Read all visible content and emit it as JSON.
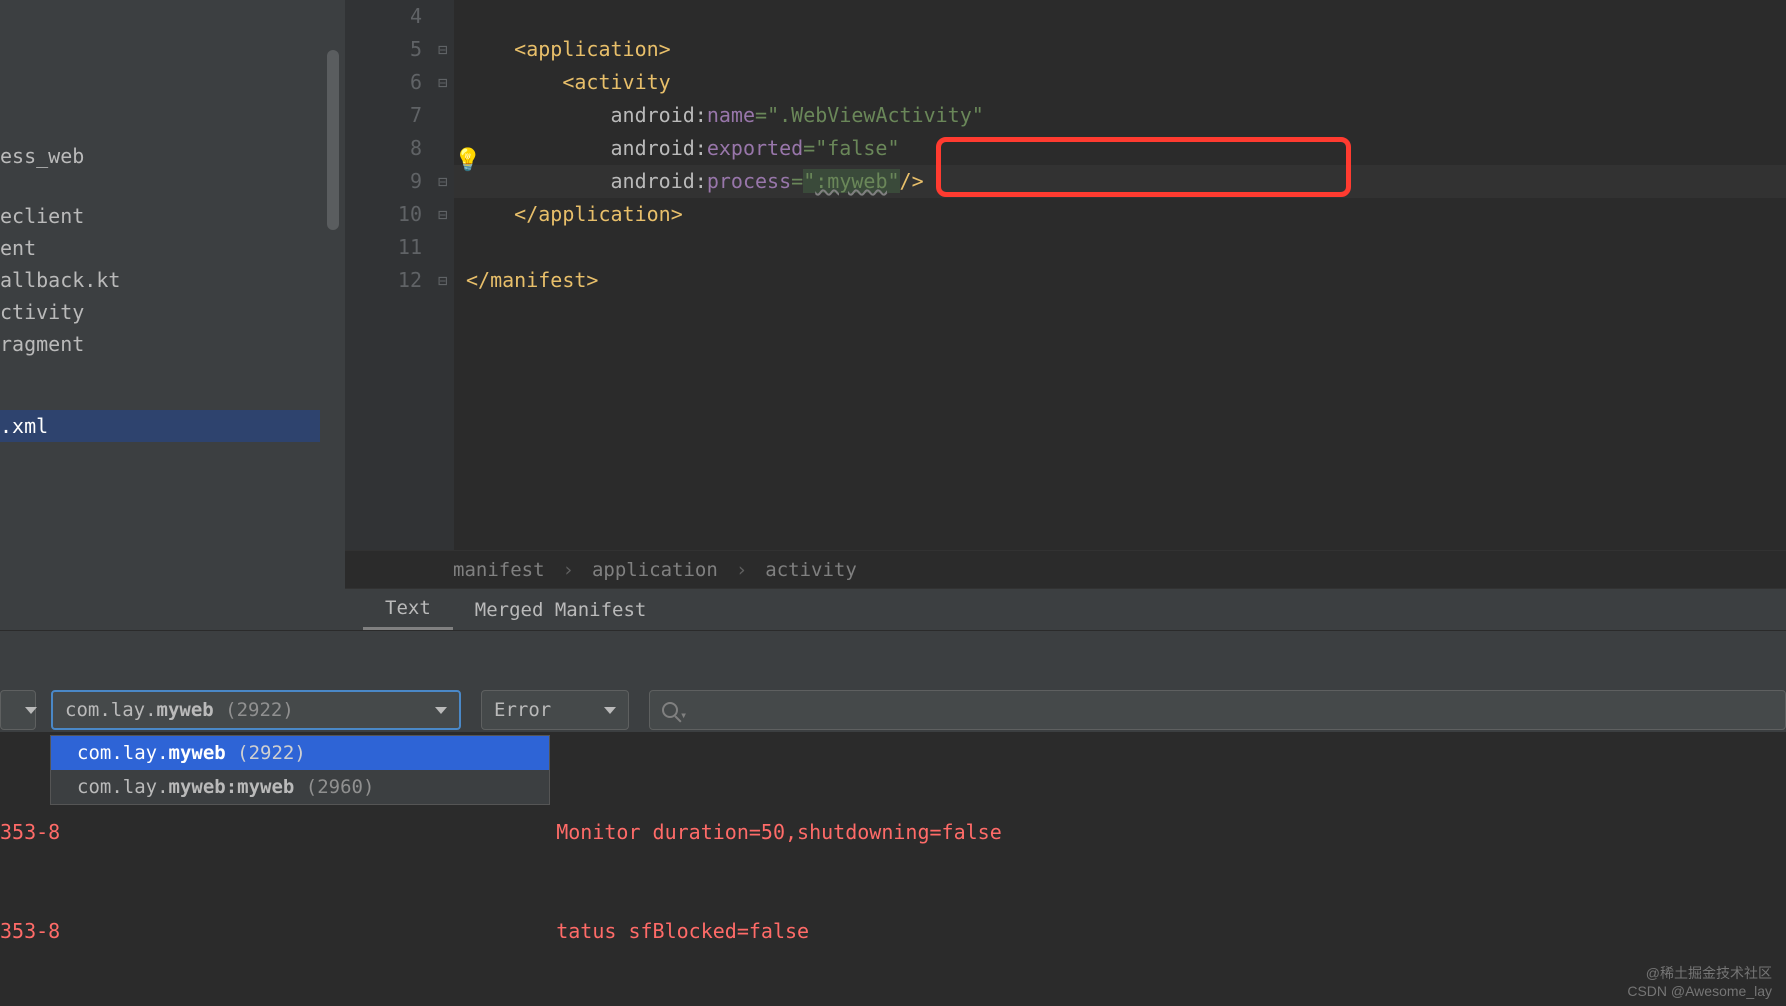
{
  "sidebar": {
    "items": [
      {
        "label": "ess_web"
      },
      {
        "label": "eclient"
      },
      {
        "label": "ent"
      },
      {
        "label": "allback.kt"
      },
      {
        "label": "ctivity"
      },
      {
        "label": "ragment"
      },
      {
        "label": ".xml",
        "selected": true
      }
    ]
  },
  "editor": {
    "lines": [
      "4",
      "5",
      "6",
      "7",
      "8",
      "9",
      "10",
      "11",
      "12"
    ],
    "code": {
      "l5": {
        "indent": "    ",
        "tag_open": "<",
        "tag": "application",
        "tag_close": ">"
      },
      "l6": {
        "indent": "        ",
        "tag_open": "<",
        "tag": "activity"
      },
      "l7": {
        "indent": "            ",
        "ns": "android",
        "colon": ":",
        "name": "name",
        "eq": "=",
        "q1": "\"",
        "val": ".WebViewActivity",
        "q2": "\""
      },
      "l8": {
        "indent": "            ",
        "ns": "android",
        "colon": ":",
        "name": "exported",
        "eq": "=",
        "q1": "\"",
        "val": "false",
        "q2": "\""
      },
      "l9": {
        "indent": "            ",
        "ns": "android",
        "colon": ":",
        "name": "process",
        "eq": "=",
        "q1": "\"",
        "val": ":myweb",
        "q2": "\"",
        "close": "/>"
      },
      "l10": {
        "indent": "    ",
        "tag_open": "</",
        "tag": "application",
        "tag_close": ">"
      },
      "l12": {
        "tag_open": "</",
        "tag": "manifest",
        "tag_close": ">"
      }
    }
  },
  "breadcrumb": {
    "items": [
      "manifest",
      "application",
      "activity"
    ]
  },
  "tabs": {
    "items": [
      {
        "label": "Text",
        "active": true
      },
      {
        "label": "Merged Manifest",
        "active": false
      }
    ]
  },
  "logcat": {
    "process_dropdown": {
      "prefix": "com.lay.",
      "bold": "myweb",
      "suffix": " (2922)"
    },
    "level_dropdown": "Error",
    "popup_items": [
      {
        "prefix": "com.lay.",
        "bold": "myweb",
        "suffix": " (2922)",
        "selected": true
      },
      {
        "prefix": "com.lay.",
        "bold": "myweb:myweb",
        "suffix": " (2960)",
        "selected": false
      }
    ]
  },
  "log_lines": {
    "l1a": "353-8",
    "l1b": "Monitor duration=50,shutdowning=false",
    "l2a": "353-8",
    "l2b": "tatus sfBlocked=false"
  },
  "watermark": {
    "line1": "@稀土掘金技术社区",
    "line2": "CSDN @Awesome_lay"
  }
}
